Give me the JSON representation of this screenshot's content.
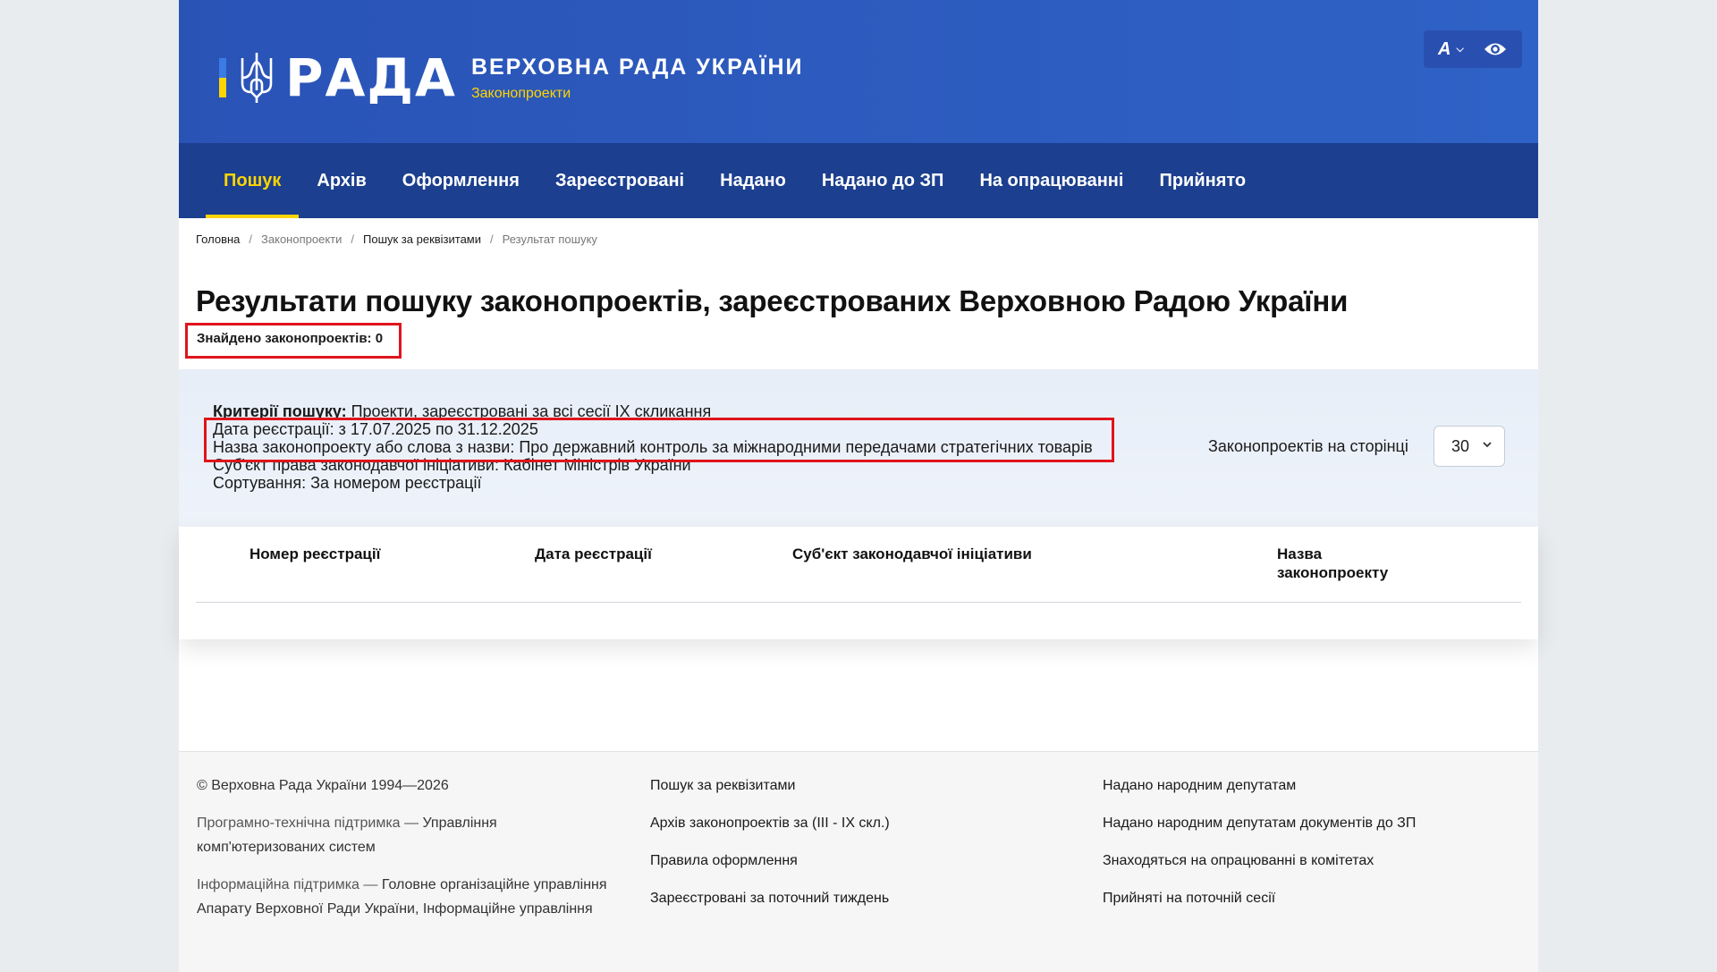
{
  "header": {
    "logo_word": "РАДА",
    "logo_title": "ВЕРХОВНА РАДА УКРАЇНИ",
    "logo_subtitle": "Законопроекти",
    "font_tool_label": "А",
    "colors": {
      "header_bg": "#2f62c6",
      "nav_bg": "#1c3f8f",
      "accent": "#ffd500"
    }
  },
  "nav": {
    "items": [
      {
        "label": "Пошук",
        "active": true
      },
      {
        "label": "Архів"
      },
      {
        "label": "Оформлення"
      },
      {
        "label": "Зареєстровані"
      },
      {
        "label": "Надано"
      },
      {
        "label": "Надано до ЗП"
      },
      {
        "label": "На опрацюванні"
      },
      {
        "label": "Прийнято"
      }
    ]
  },
  "breadcrumb": {
    "items": [
      "Головна",
      "Законопроекти",
      "Пошук за реквізитами",
      "Результат пошуку"
    ],
    "separator": "/"
  },
  "page_title": "Результати пошуку законопроектів, зареєстрованих Верховною Радою України",
  "found_count": "Знайдено законопроектів: 0",
  "criteria": {
    "criteria_label": "Критерії пошуку:",
    "criteria_value": "Проекти, зареєстровані за всі сесії IX скликання",
    "date_line": "Дата реєстрації: з 17.07.2025 по 31.12.2025",
    "name_line": "Назва законопроекту або слова з назви: Про державний контроль за міжнародними передачами стратегічних товарів",
    "subject_line": "Суб'єкт права законодавчої ініціативи: Кабінет Міністрів України",
    "sort_line": "Сортування: За номером реєстрації"
  },
  "per_page": {
    "label": "Законопроектів на сторінці",
    "value": "30"
  },
  "table": {
    "headers": [
      "Номер реєстрації",
      "Дата реєстрації",
      "Суб'єкт законодавчої ініціативи",
      "Назва законопроекту"
    ],
    "rows": []
  },
  "footer": {
    "copyright": "© Верховна Рада України 1994—2026",
    "support_tech_prefix": "Програмно-технічна підтримка — ",
    "support_tech": "Управління комп'ютеризованих систем",
    "support_info_prefix": "Інформаційна підтримка — ",
    "support_info": "Головне організаційне управління Апарату Верховної Ради України, Інформаційне управління",
    "col2": [
      "Пошук за реквізитами",
      "Архів законопроектів за (III - IX скл.)",
      "Правила оформлення",
      "Зареєстровані за поточний тиждень"
    ],
    "col3": [
      "Надано народним депутатам",
      "Надано народним депутатам документів до ЗП",
      "Знаходяться на опрацюванні в комітетах",
      "Прийняті на поточній сесії"
    ]
  }
}
